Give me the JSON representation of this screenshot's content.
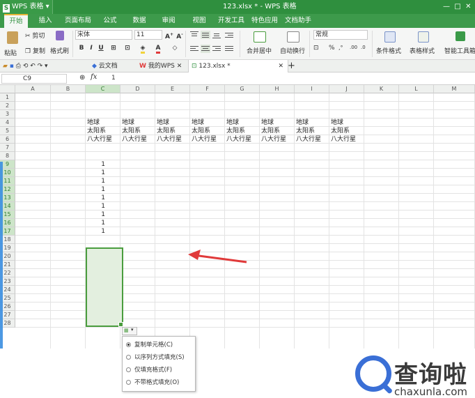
{
  "app": {
    "name": "WPS 表格",
    "logo_letter": "S",
    "window_title": "123.xlsx * - WPS 表格"
  },
  "menu": [
    "开始",
    "插入",
    "页面布局",
    "公式",
    "数据",
    "审阅",
    "视图",
    "开发工具",
    "特色应用",
    "文档助手"
  ],
  "ribbon": {
    "paste": "粘贴",
    "cut": "剪切",
    "copy": "复制",
    "format_painter": "格式刷",
    "font_name": "宋体",
    "font_size": "11",
    "bold": "B",
    "italic": "I",
    "underline": "U",
    "merge": "合并居中",
    "wrap": "自动换行",
    "number_format": "常规",
    "percent": "%",
    "cond_format": "条件格式",
    "table_style": "表格样式",
    "smart_toolbox": "智能工具箱"
  },
  "tabs": {
    "cloud": "云文档",
    "mywps": "我的WPS",
    "file": "123.xlsx *"
  },
  "formula_bar": {
    "name_box": "C9",
    "fx": "fx",
    "value": "1"
  },
  "grid": {
    "columns": [
      "A",
      "B",
      "C",
      "D",
      "E",
      "F",
      "G",
      "H",
      "I",
      "J",
      "K",
      "L",
      "M"
    ],
    "rows": [
      "1",
      "2",
      "3",
      "4",
      "5",
      "6",
      "7",
      "8",
      "9",
      "10",
      "11",
      "12",
      "13",
      "14",
      "15",
      "16",
      "17",
      "18",
      "19",
      "20",
      "21",
      "22",
      "23",
      "24",
      "25",
      "26",
      "27",
      "28"
    ],
    "selected_column": "C",
    "text_cells": [
      "地球",
      "太阳系",
      "八大行星"
    ],
    "number_value": "1"
  },
  "autofill": {
    "options": [
      "复制单元格(C)",
      "以序列方式填充(S)",
      "仅填充格式(F)",
      "不带格式填充(O)"
    ],
    "selected_index": 0
  },
  "watermark": {
    "text": "查询啦",
    "url": "chaxunla.com"
  },
  "colors": {
    "wps_green": "#2f8f3e",
    "selection": "#4a9d3e",
    "arrow": "#e03a3a",
    "watermark_blue": "#3a6fd6"
  }
}
